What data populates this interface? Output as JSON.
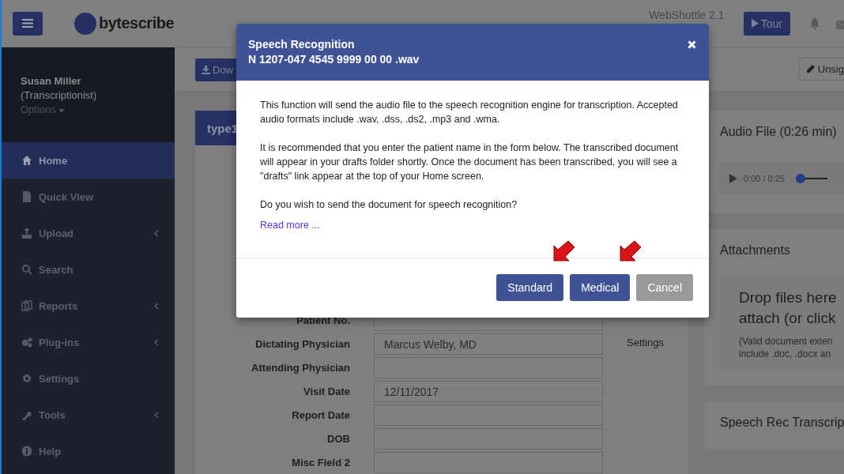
{
  "header": {
    "logo": "bytescribe",
    "version": "WebShuttle 2.1",
    "tour_button": "Tour"
  },
  "user": {
    "name": "Susan Miller",
    "role": "(Transcriptionist)",
    "options": "Options"
  },
  "sidebar": {
    "items": [
      {
        "label": "Home",
        "kind": "home",
        "selected": true,
        "expandable": false
      },
      {
        "label": "Quick View",
        "kind": "file",
        "selected": false,
        "expandable": false
      },
      {
        "label": "Upload",
        "kind": "upload",
        "selected": false,
        "expandable": true
      },
      {
        "label": "Search",
        "kind": "search",
        "selected": false,
        "expandable": false
      },
      {
        "label": "Reports",
        "kind": "reports",
        "selected": false,
        "expandable": true
      },
      {
        "label": "Plug-ins",
        "kind": "plugins",
        "selected": false,
        "expandable": true
      },
      {
        "label": "Settings",
        "kind": "settings",
        "selected": false,
        "expandable": false
      },
      {
        "label": "Tools",
        "kind": "tools",
        "selected": false,
        "expandable": true
      },
      {
        "label": "Help",
        "kind": "help",
        "selected": false,
        "expandable": false
      }
    ]
  },
  "toolbar": {
    "download_button": "Dow",
    "unsign_button": "Unsig"
  },
  "form": {
    "title": "type1",
    "side_link": "Settings",
    "fields": [
      {
        "label": "Patient No."
      },
      {
        "label": "Dictating Physician",
        "value": "Marcus Welby, MD"
      },
      {
        "label": "Attending Physician"
      },
      {
        "label": "Visit Date",
        "value": "12/11/2017"
      },
      {
        "label": "Report Date"
      },
      {
        "label": "DOB"
      },
      {
        "label": "Misc Field 2"
      }
    ]
  },
  "audio": {
    "title": "Audio File (0:26 min)",
    "time": "0:00 / 0:25",
    "level": 0
  },
  "attachments": {
    "title": "Attachments",
    "drop_lines": [
      "Drop files here",
      "attach (or click"
    ],
    "note_lines": [
      "(Valid document exten",
      "include .doc, .docx an"
    ]
  },
  "speech_rec": {
    "title": "Speech Rec Transcrip"
  },
  "dialog": {
    "title": "Speech Recognition",
    "filename": "N 1207-047 4545 9999 00 00 .wav",
    "paragraphs": [
      "This function will send the audio file to the speech recognition engine for transcription. Accepted audio formats include .wav, .dss, .ds2, .mp3 and .wma.",
      "It is recommended that you enter the patient name in the form below. The transcribed document will appear in your drafts folder shortly. Once the document has been transcribed, you will see a \"drafts\" link appear at the top of your Home screen.",
      "Do you wish to send the document for speech recognition?"
    ],
    "link": "Read more ...",
    "buttons": [
      {
        "label": "Standard",
        "disabled": false,
        "highlighted": true
      },
      {
        "label": "Medical",
        "disabled": false,
        "highlighted": true
      },
      {
        "label": "Cancel",
        "disabled": true,
        "highlighted": false
      }
    ]
  }
}
